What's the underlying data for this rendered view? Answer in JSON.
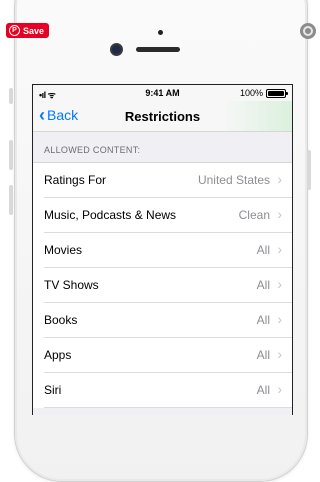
{
  "overlay": {
    "save_label": "Save",
    "pin_glyph": "P",
    "pin_icon": "pinterest-icon",
    "expand_icon": "expand-icon"
  },
  "status_bar": {
    "signal": "•ıl ᯤ",
    "time": "9:41 AM",
    "battery": "100%"
  },
  "nav": {
    "back_label": "Back",
    "title": "Restrictions"
  },
  "section": {
    "header": "ALLOWED CONTENT:"
  },
  "rows": [
    {
      "label": "Ratings For",
      "value": "United States"
    },
    {
      "label": "Music, Podcasts & News",
      "value": "Clean"
    },
    {
      "label": "Movies",
      "value": "All"
    },
    {
      "label": "TV Shows",
      "value": "All"
    },
    {
      "label": "Books",
      "value": "All"
    },
    {
      "label": "Apps",
      "value": "All"
    },
    {
      "label": "Siri",
      "value": "All"
    }
  ],
  "colors": {
    "accent": "#007aff",
    "save_red": "#e60023",
    "secondary_text": "#8e8e93"
  }
}
